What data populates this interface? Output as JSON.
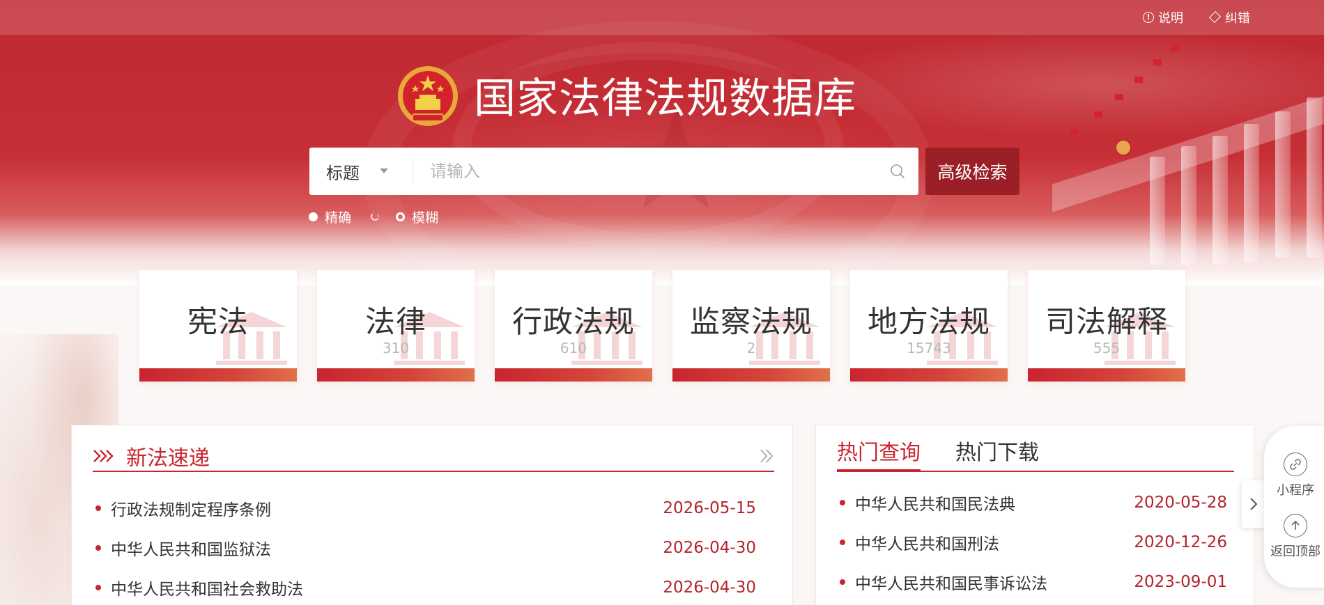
{
  "topbar": {
    "help_label": "说明",
    "feedback_label": "纠错"
  },
  "site": {
    "title": "国家法律法规数据库"
  },
  "search": {
    "scope_value": "标题",
    "placeholder": "请输入",
    "advanced_label": "高级检索",
    "match_modes": {
      "exact_label": "精确",
      "fuzzy_label": "模糊"
    }
  },
  "categories": [
    {
      "name": "宪法",
      "count": ""
    },
    {
      "name": "法律",
      "count": "310"
    },
    {
      "name": "行政法规",
      "count": "610"
    },
    {
      "name": "监察法规",
      "count": "2"
    },
    {
      "name": "地方法规",
      "count": "15743"
    },
    {
      "name": "司法解释",
      "count": "555"
    }
  ],
  "new_laws": {
    "title": "新法速递",
    "items": [
      {
        "title": "行政法规制定程序条例",
        "date": "2026-05-15"
      },
      {
        "title": "中华人民共和国监狱法",
        "date": "2026-04-30"
      },
      {
        "title": "中华人民共和国社会救助法",
        "date": "2026-04-30"
      }
    ]
  },
  "hot": {
    "tabs": [
      {
        "label": "热门查询"
      },
      {
        "label": "热门下载"
      }
    ],
    "items": [
      {
        "title": "中华人民共和国民法典",
        "date": "2020-05-28"
      },
      {
        "title": "中华人民共和国刑法",
        "date": "2020-12-26"
      },
      {
        "title": "中华人民共和国民事诉讼法",
        "date": "2023-09-01"
      }
    ]
  },
  "side": {
    "mini_program_label": "小程序",
    "back_to_top_label": "返回顶部"
  },
  "colors": {
    "brand_red": "#c9242f",
    "dark_red": "#9a1f27",
    "date_red": "#b4232c"
  }
}
